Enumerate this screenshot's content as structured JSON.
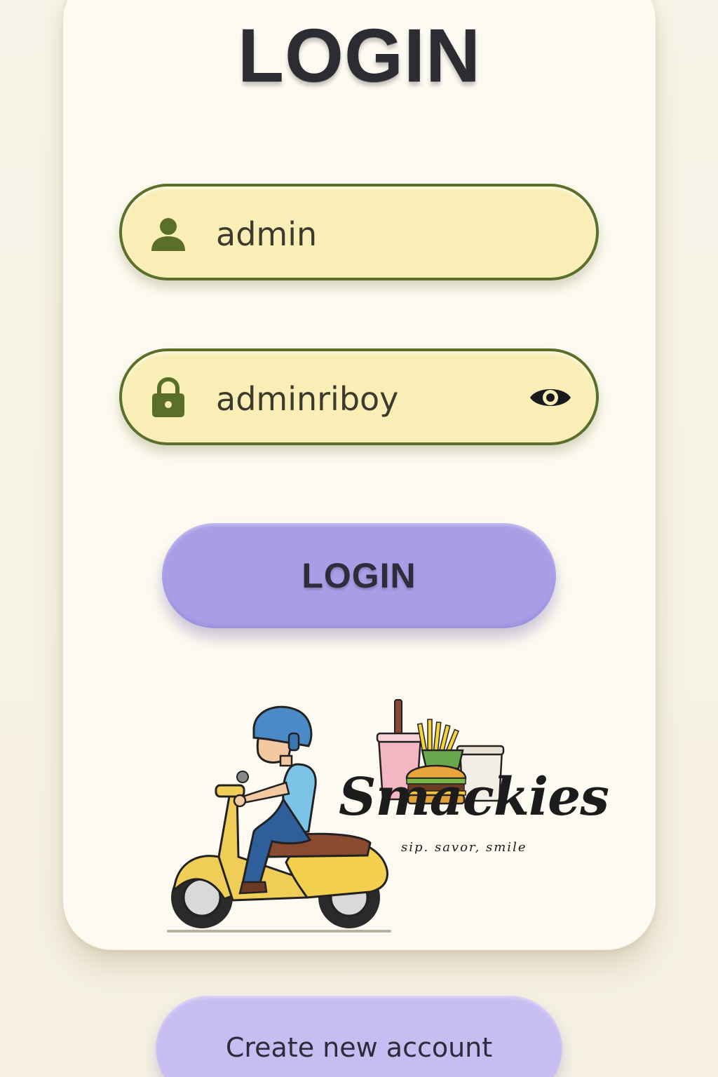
{
  "title": "LOGIN",
  "username": {
    "value": "admin",
    "icon": "user-icon"
  },
  "password": {
    "value": "adminriboy",
    "icon": "lock-icon",
    "toggle_icon": "eye-icon"
  },
  "login_button": {
    "label": "LOGIN"
  },
  "brand": {
    "name": "Smackies",
    "tagline": "sip. savor, smile"
  },
  "create_account_button": {
    "label": "Create new account"
  },
  "colors": {
    "background": "#f7f3e7",
    "card": "#fdfbf1",
    "field_fill": "#f8eeb6",
    "field_border": "#5a6f2a",
    "primary_button": "#a99ee6",
    "secondary_button": "#c7bdf0"
  }
}
